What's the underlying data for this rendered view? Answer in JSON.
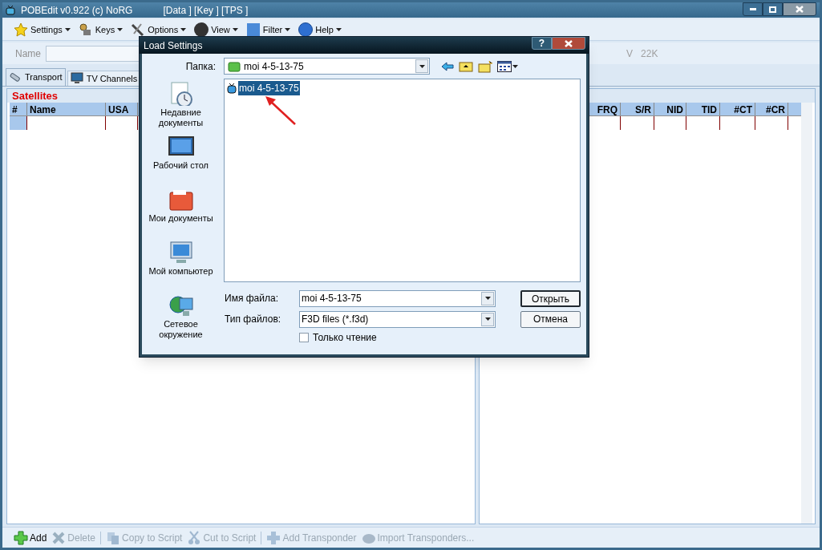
{
  "window": {
    "title": "POBEdit v0.922 (c) NoRG",
    "subtitle": "[Data ] [Key ] [TPS ]"
  },
  "menu": [
    {
      "kind": "star",
      "label": "Settings"
    },
    {
      "kind": "keys",
      "label": "Keys"
    },
    {
      "kind": "options",
      "label": "Options"
    },
    {
      "kind": "view",
      "label": "View"
    },
    {
      "kind": "filter",
      "label": "Filter"
    },
    {
      "kind": "help",
      "label": "Help"
    }
  ],
  "name_bar": {
    "label": "Name",
    "info": [
      "V",
      "22K"
    ]
  },
  "tabs": [
    {
      "kind": "transport",
      "label": "Transport",
      "selected": true
    },
    {
      "kind": "tv",
      "label": "TV Channels",
      "selected": false
    }
  ],
  "satellites": {
    "title": "Satellites",
    "columns": [
      "#",
      "Name",
      "USA"
    ]
  },
  "transponders": {
    "columns": [
      "FRQ",
      "S/R",
      "NID",
      "TID",
      "#CT",
      "#CR"
    ]
  },
  "bottom_toolbar": [
    {
      "kind": "add",
      "label": "Add",
      "disabled": false
    },
    {
      "kind": "delete",
      "label": "Delete",
      "disabled": true
    },
    {
      "kind": "copy",
      "label": "Copy to Script",
      "disabled": true
    },
    {
      "kind": "cut",
      "label": "Cut to Script",
      "disabled": true
    },
    {
      "kind": "plus",
      "label": "Add Transponder",
      "disabled": true
    },
    {
      "kind": "import",
      "label": "Import Transponders...",
      "disabled": true
    }
  ],
  "dialog": {
    "title": "Load Settings",
    "help_button": "?",
    "folder_label": "Папка:",
    "folder": "moi 4-5-13-75",
    "places": [
      {
        "kind": "recent",
        "label": "Недавние документы"
      },
      {
        "kind": "desktop",
        "label": "Рабочий стол"
      },
      {
        "kind": "documents",
        "label": "Мои документы"
      },
      {
        "kind": "computer",
        "label": "Мой компьютер"
      },
      {
        "kind": "network",
        "label": "Сетевое окружение"
      }
    ],
    "files": [
      {
        "name": "moi 4-5-13-75",
        "selected": true
      }
    ],
    "file_name_label": "Имя файла:",
    "file_name": "moi 4-5-13-75",
    "file_type_label": "Тип файлов:",
    "file_type": "F3D files (*.f3d)",
    "read_only": {
      "label": "Только чтение",
      "checked": false
    },
    "buttons": [
      {
        "label": "Открыть",
        "default": true
      },
      {
        "label": "Отмена",
        "default": false
      }
    ]
  }
}
